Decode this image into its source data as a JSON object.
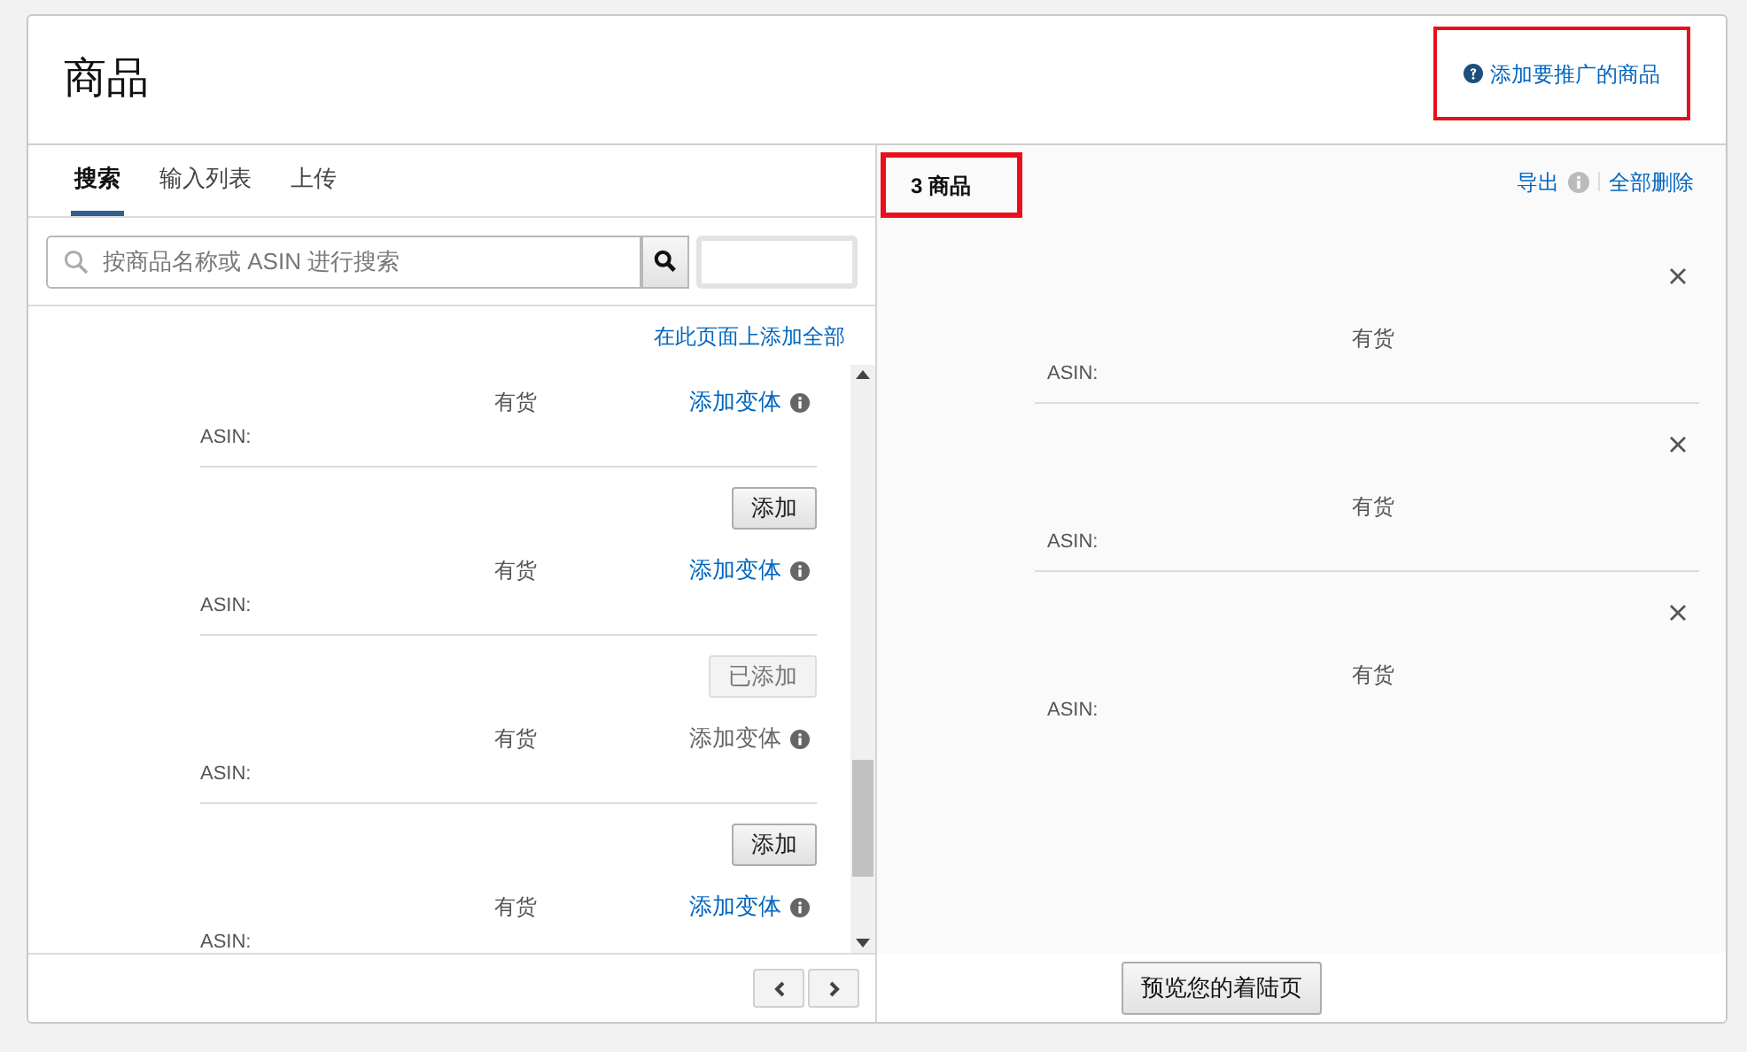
{
  "page": {
    "title": "商品",
    "help_link": {
      "label": "添加要推广的商品",
      "highlighted": true
    }
  },
  "left": {
    "tabs": [
      {
        "label": "搜索",
        "selected": true
      },
      {
        "label": "输入列表",
        "selected": false
      },
      {
        "label": "上传",
        "selected": false
      }
    ],
    "search": {
      "placeholder": "按商品名称或 ASIN 进行搜索"
    },
    "add_all_link": "在此页面上添加全部",
    "results": [
      {
        "availability": "有货",
        "variants_link": "添加变体",
        "variants_enabled": true,
        "asin_label": "ASIN:"
      },
      {
        "button": {
          "label": "添加",
          "disabled": false
        },
        "availability": "有货",
        "variants_link": "添加变体",
        "variants_enabled": true,
        "asin_label": "ASIN:"
      },
      {
        "button": {
          "label": "已添加",
          "disabled": true
        },
        "availability": "有货",
        "variants_link": "添加变体",
        "variants_enabled": false,
        "asin_label": "ASIN:"
      },
      {
        "button": {
          "label": "添加",
          "disabled": false
        },
        "availability": "有货",
        "variants_link": "添加变体",
        "variants_enabled": true,
        "asin_label": "ASIN:"
      }
    ]
  },
  "right": {
    "count": {
      "label": "3 商品",
      "highlighted": true
    },
    "export_link": "导出",
    "delete_all_link": "全部删除",
    "items": [
      {
        "availability": "有货",
        "asin_label": "ASIN:"
      },
      {
        "availability": "有货",
        "asin_label": "ASIN:"
      },
      {
        "availability": "有货",
        "asin_label": "ASIN:"
      }
    ],
    "preview_button": "预览您的着陆页"
  }
}
